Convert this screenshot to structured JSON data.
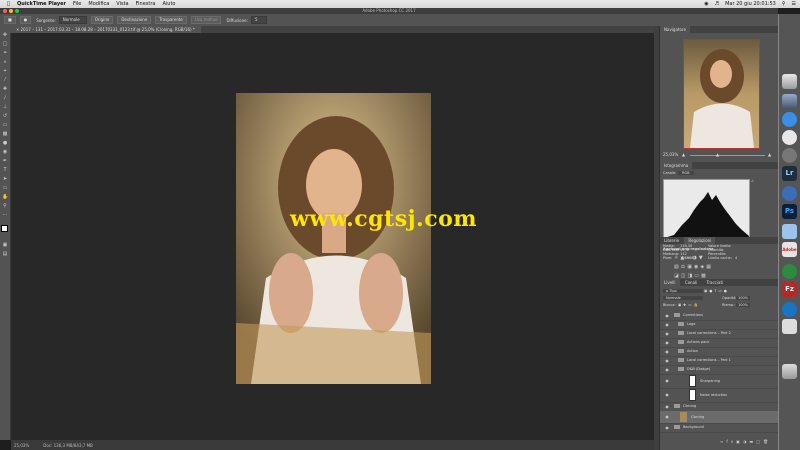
{
  "menubar": {
    "app": "QuickTime Player",
    "items": [
      "File",
      "Modifica",
      "Vista",
      "Finestra",
      "Aiuto"
    ],
    "clock": "Mar 20 giu  20:01:53"
  },
  "window": {
    "title": "Adobe Photoshop CC 2017"
  },
  "options": {
    "sorgente_label": "Sorgente:",
    "sorgente_value": "Normale",
    "origine_label": "Origine",
    "destinazione_label": "Destinazione",
    "trasparente_label": "Trasparente",
    "usa_motivo_label": "Usa motivo",
    "diffusione_label": "Diffusione:",
    "diffusione_value": "5"
  },
  "document": {
    "tab_title": "2017 – 131 – 2017.03.31 – 18.08.28 – 20170331_0123.tif @ 25,0% (Cloning, RGB/16) *",
    "zoom": "25,03%",
    "doc_size": "Doc: 136,3 MB/843,7 MB"
  },
  "watermark": "www.cgtsj.com",
  "panels": {
    "navigator": {
      "tab": "Navigatore",
      "zoom": "25,03%"
    },
    "histogram": {
      "tab": "Istogramma",
      "channel_label": "Canale:",
      "channel_value": "RGB",
      "origin_label": "Origine:",
      "origin_value": "Immagine intera",
      "stats": [
        {
          "label": "Media:",
          "value": "116,30"
        },
        {
          "label": "Dev. std:",
          "value": "49,47"
        },
        {
          "label": "Mediana:",
          "value": "112"
        },
        {
          "label": "Pixel:",
          "value": "1064460"
        },
        {
          "label": "Valore livello:",
          "value": ""
        },
        {
          "label": "Quantità:",
          "value": ""
        },
        {
          "label": "Percentile:",
          "value": ""
        },
        {
          "label": "Livello cache:",
          "value": "4"
        }
      ]
    },
    "adjustments": {
      "tabs": [
        "Librerie",
        "Regolazioni"
      ],
      "hint": "Aggiungi una regolazione"
    },
    "layers": {
      "tabs": [
        "Livelli",
        "Canali",
        "Tracciati"
      ],
      "filter_label": "ρ Tipo",
      "blend_mode": "Normale",
      "opacity_label": "Opacità:",
      "opacity_value": "100%",
      "lock_label": "Blocca:",
      "fill_label": "Riemp.:",
      "fill_value": "100%",
      "items": [
        {
          "name": "Corrections",
          "kind": "group"
        },
        {
          "name": "Logo",
          "kind": "group"
        },
        {
          "name": "Local corrections – Part 2",
          "kind": "group"
        },
        {
          "name": "Actions pack",
          "kind": "group"
        },
        {
          "name": "Action",
          "kind": "group"
        },
        {
          "name": "Local corrections – Part 1",
          "kind": "group"
        },
        {
          "name": "D&B (Dodge)",
          "kind": "group"
        },
        {
          "name": "Sharpening",
          "kind": "mask"
        },
        {
          "name": "Noise reduction",
          "kind": "mask"
        },
        {
          "name": "Cloning",
          "kind": "group"
        },
        {
          "name": "Cloning",
          "kind": "pixel"
        },
        {
          "name": "Background",
          "kind": "group"
        }
      ]
    }
  },
  "dock": [
    "",
    "",
    "",
    "",
    "Lr",
    "",
    "Ps",
    "",
    "Adobe",
    "",
    "Fz",
    "",
    "",
    ""
  ]
}
